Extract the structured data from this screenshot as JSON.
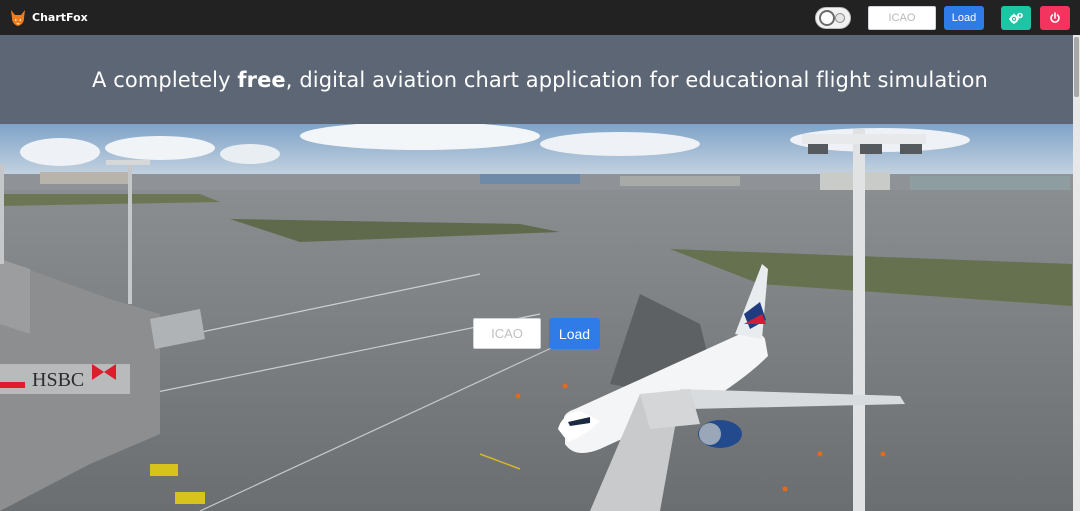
{
  "app": {
    "brand": "ChartFox"
  },
  "navbar": {
    "icao_placeholder": "ICAO",
    "load_label": "Load",
    "theme_toggle": "theme-toggle",
    "settings_icon": "gears-icon",
    "power_icon": "power-icon"
  },
  "banner": {
    "text_before": "A completely ",
    "text_bold": "free",
    "text_after": ", digital aviation chart application for educational flight simulation"
  },
  "hero": {
    "icao_placeholder": "ICAO",
    "load_label": "Load",
    "billboard_text": "HSBC"
  },
  "colors": {
    "navbar": "#222222",
    "banner": "#5c6675",
    "primary_blue": "#2f7be8",
    "teal": "#1cc6a5",
    "red": "#f2345e"
  }
}
